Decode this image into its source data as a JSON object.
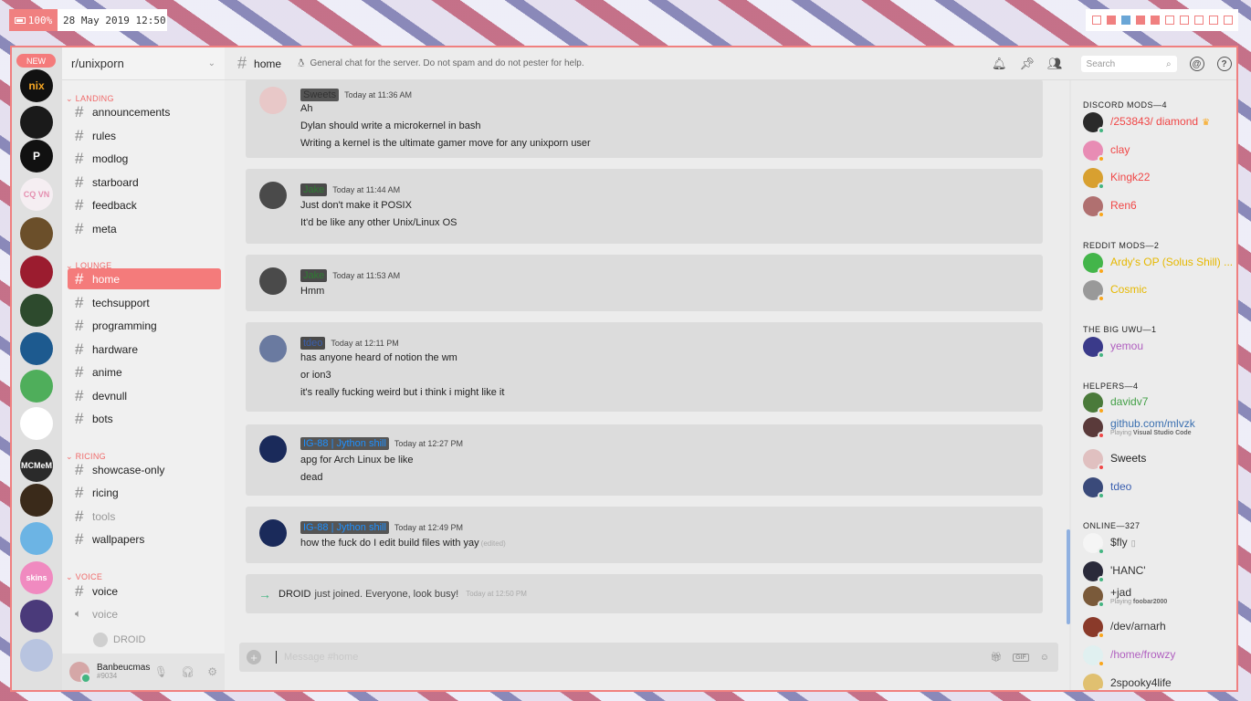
{
  "statusbar": {
    "battery": "100%",
    "datetime": "28 May 2019 12:50",
    "workspaces": [
      "empty",
      "filled",
      "active",
      "filled",
      "filled",
      "empty",
      "empty",
      "empty",
      "empty",
      "empty"
    ]
  },
  "colors": {
    "accent": "#f47b7b",
    "online": "#43b581",
    "idle": "#faa61a",
    "dnd": "#f04747"
  },
  "guilds": {
    "new_badge": "NEW",
    "items": [
      {
        "label": "nix",
        "color": "#111111",
        "text_color": "#f5a623"
      },
      {
        "label": "",
        "color": "#1a1a1a"
      },
      {
        "label": "P",
        "color": "#111111"
      },
      {
        "label": "CQ VN",
        "color": "#f5eef2",
        "text_color": "#e58fb0"
      },
      {
        "label": "",
        "color": "#6b4f2a"
      },
      {
        "label": "",
        "color": "#9b1c2f"
      },
      {
        "label": "",
        "color": "#2d4a2d"
      },
      {
        "label": "",
        "color": "#1d5a8f"
      },
      {
        "label": "",
        "color": "#4fae5b"
      },
      {
        "label": "",
        "color": "#ffffff"
      },
      {
        "label": "MCMeM",
        "color": "#2a2a2a"
      },
      {
        "label": "",
        "color": "#3a2a1a"
      },
      {
        "label": "",
        "color": "#6cb4e4"
      },
      {
        "label": "skins",
        "color": "#f08ac0"
      },
      {
        "label": "",
        "color": "#4a3a7a",
        "mentions": "1"
      },
      {
        "label": "",
        "color": "#b8c4e0"
      }
    ]
  },
  "server": {
    "name": "r/unixporn"
  },
  "categories": {
    "landing": "LANDING",
    "lounge": "LOUNGE",
    "ricing": "RICING",
    "voice": "VOICE"
  },
  "channels": {
    "landing": [
      "announcements",
      "rules",
      "modlog",
      "starboard",
      "feedback",
      "meta"
    ],
    "lounge": [
      "home",
      "techsupport",
      "programming",
      "hardware",
      "anime",
      "devnull",
      "bots"
    ],
    "ricing": [
      "showcase-only",
      "ricing",
      "tools",
      "wallpapers"
    ],
    "voice_text": "voice",
    "voice_channel": "voice",
    "voice_user": "DROID"
  },
  "user": {
    "name": "Banbeucmas",
    "tag": "#9034"
  },
  "header": {
    "channel": "home",
    "topic": "General chat for the server. Do not spam and do not pester for help.",
    "search_placeholder": "Search"
  },
  "messages": [
    {
      "author": "Sweets",
      "time": "Today at 11:36 AM",
      "lines": [
        "Ah",
        "Dylan should write a microkernel in bash",
        "Writing a kernel is the ultimate gamer move for any unixporn user"
      ]
    },
    {
      "author": "Jake",
      "time": "Today at 11:44 AM",
      "lines": [
        "Just don't make it POSIX",
        "It'd be like any other Unix/Linux OS"
      ]
    },
    {
      "author": "Jake",
      "time": "Today at 11:53 AM",
      "lines": [
        "Hmm"
      ]
    },
    {
      "author": "tdeo",
      "time": "Today at 12:11 PM",
      "lines": [
        "has anyone heard of notion the wm",
        "or ion3",
        "it's really fucking weird but i think i might like it"
      ]
    },
    {
      "author": "IG-88 | Jython shill",
      "time": "Today at 12:27 PM",
      "lines": [
        "apg for Arch Linux be like",
        "dead"
      ]
    },
    {
      "author": "IG-88 | Jython shill",
      "time": "Today at 12:49 PM",
      "lines": [
        "how the fuck do I edit build files with yay"
      ],
      "edited": "(edited)"
    }
  ],
  "join": {
    "name": "DROID",
    "text": "just joined. Everyone, look busy!",
    "time": "Today at 12:50 PM"
  },
  "composer": {
    "placeholder": "Message #home"
  },
  "members": {
    "groups": [
      {
        "title": "DISCORD MODS—4",
        "items": [
          {
            "name": "/253843/ diamond",
            "color": "#f04747",
            "crown": "♛",
            "status": "online"
          },
          {
            "name": "clay",
            "color": "#f04747",
            "status": "idle"
          },
          {
            "name": "Kingk22",
            "color": "#f04747",
            "status": "online"
          },
          {
            "name": "Ren6",
            "color": "#f04747",
            "status": "idle"
          }
        ]
      },
      {
        "title": "REDDIT MODS—2",
        "items": [
          {
            "name": "Ardy's OP (Solus Shill) ...",
            "color": "#e6b800",
            "status": "idle"
          },
          {
            "name": "Cosmic",
            "color": "#e6b800",
            "status": "idle"
          }
        ]
      },
      {
        "title": "THE BIG UWU—1",
        "items": [
          {
            "name": "yemou",
            "color": "#b05fc0",
            "status": "online"
          }
        ]
      },
      {
        "title": "HELPERS—4",
        "items": [
          {
            "name": "davidv7",
            "color": "#43a047",
            "status": "idle"
          },
          {
            "name": "github.com/mlvzk",
            "color": "#3a6fb0",
            "status": "dnd",
            "playing_label": "Playing",
            "playing": "Visual Studio Code"
          },
          {
            "name": "Sweets",
            "color": "#222222",
            "status": "dnd"
          },
          {
            "name": "tdeo",
            "color": "#3a5fb0",
            "status": "online"
          }
        ]
      },
      {
        "title": "ONLINE—327",
        "items": [
          {
            "name": "$fly",
            "color": "#333333",
            "status": "online",
            "mobile": "▯"
          },
          {
            "name": "'HANC'",
            "color": "#333333",
            "status": "online"
          },
          {
            "name": "+jad",
            "color": "#333333",
            "status": "online",
            "playing_label": "Playing",
            "playing": "foobar2000"
          },
          {
            "name": "/dev/arnarh",
            "color": "#333333",
            "status": "idle"
          },
          {
            "name": "/home/frowzy",
            "color": "#b05fc0",
            "status": "idle"
          },
          {
            "name": "2spooky4life",
            "color": "#333333",
            "status": "idle"
          }
        ]
      }
    ]
  }
}
